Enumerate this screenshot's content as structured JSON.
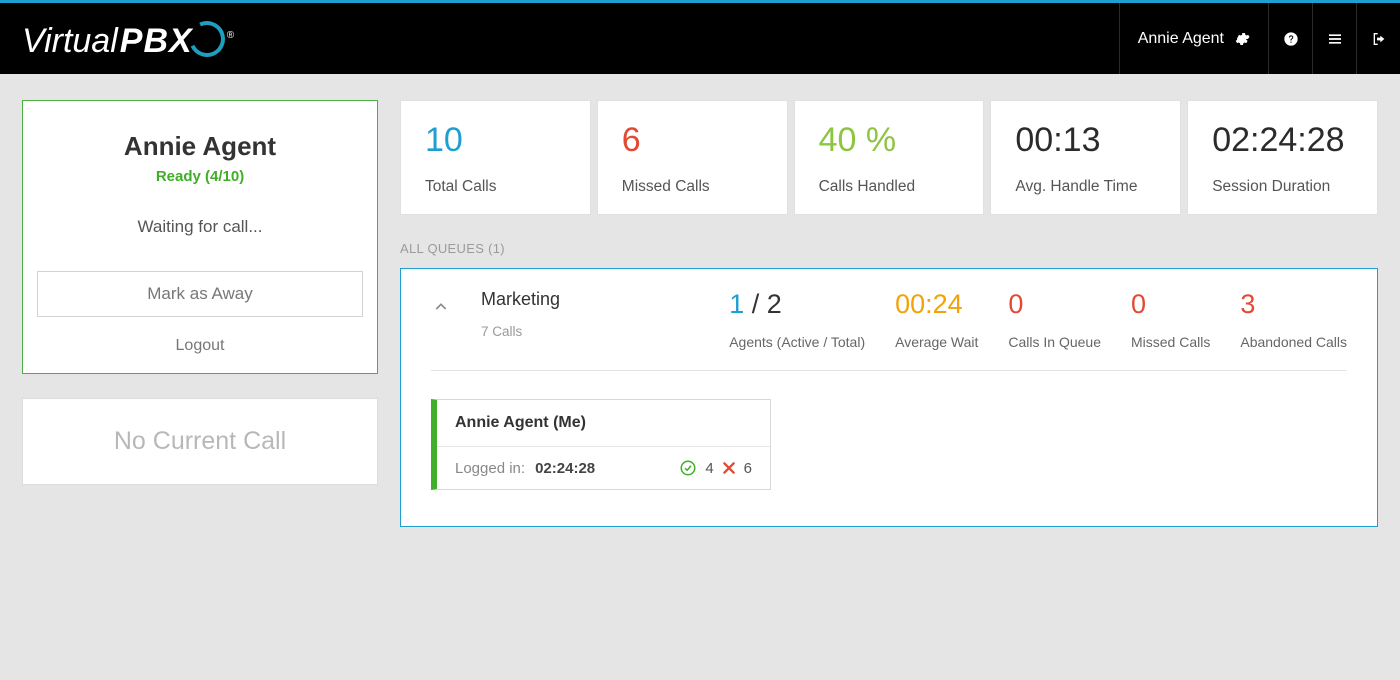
{
  "header": {
    "logo_virtual": "Virtual",
    "logo_pbx": "PBX",
    "user_name": "Annie Agent"
  },
  "agent_card": {
    "name": "Annie Agent",
    "status": "Ready (4/10)",
    "waiting": "Waiting for call...",
    "mark_away": "Mark as Away",
    "logout": "Logout"
  },
  "no_call": "No Current Call",
  "tiles": [
    {
      "value": "10",
      "label": "Total Calls",
      "color": "c-blue"
    },
    {
      "value": "6",
      "label": "Missed Calls",
      "color": "c-red"
    },
    {
      "value": "40 %",
      "label": "Calls Handled",
      "color": "c-green"
    },
    {
      "value": "00:13",
      "label": "Avg. Handle Time",
      "color": "c-dark"
    },
    {
      "value": "02:24:28",
      "label": "Session Duration",
      "color": "c-dark"
    }
  ],
  "queues_label": "ALL QUEUES (1)",
  "queue": {
    "name": "Marketing",
    "sub": "7 Calls",
    "agents_active": "1",
    "agents_sep": " / ",
    "agents_total": "2",
    "stats": [
      {
        "label": "Agents (Active / Total)"
      },
      {
        "value": "00:24",
        "label": "Average Wait",
        "color": "c-orange"
      },
      {
        "value": "0",
        "label": "Calls In Queue",
        "color": "c-red"
      },
      {
        "value": "0",
        "label": "Missed Calls",
        "color": "c-red"
      },
      {
        "value": "3",
        "label": "Abandoned Calls",
        "color": "c-red"
      }
    ],
    "agent": {
      "name": "Annie Agent (Me)",
      "logged_in_label": "Logged in:",
      "duration": "02:24:28",
      "handled": "4",
      "missed": "6"
    }
  }
}
